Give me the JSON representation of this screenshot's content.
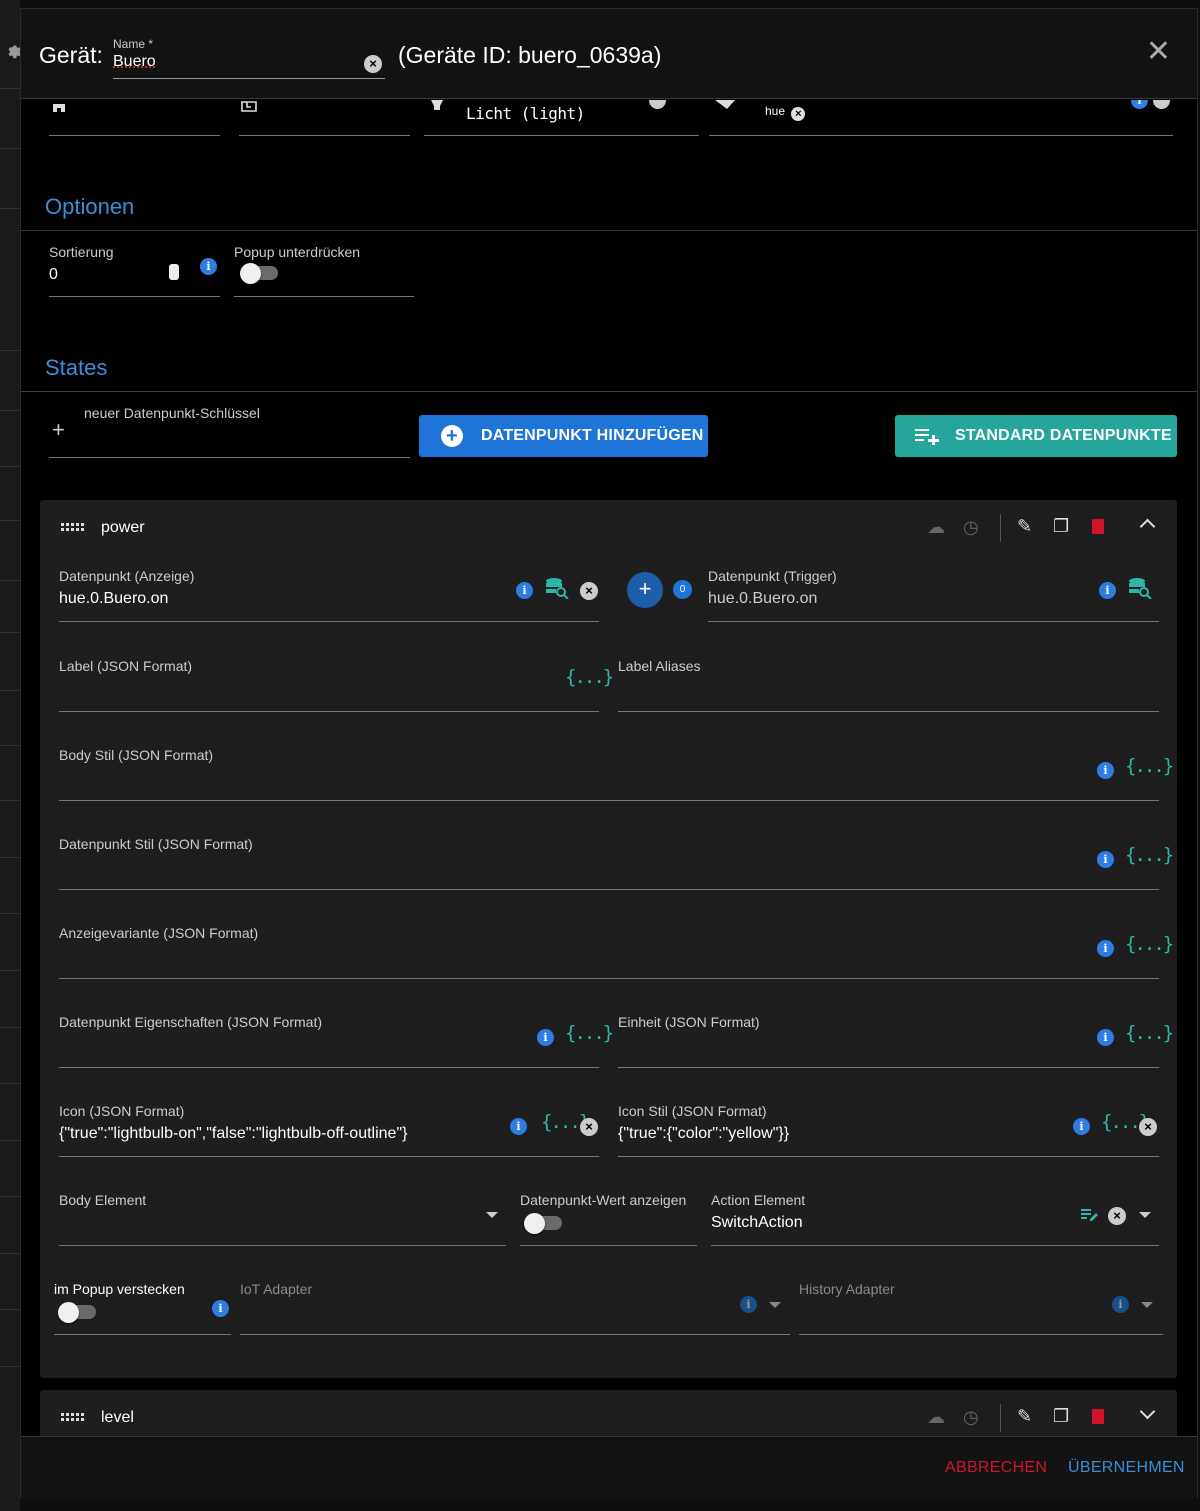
{
  "header": {
    "device_label": "Gerät:",
    "name_label": "Name *",
    "name_value": "Buero",
    "device_id": "(Geräte ID: buero_0639a)"
  },
  "top_row": {
    "function_value": "Licht (light)",
    "chip": "hue"
  },
  "options": {
    "title": "Optionen",
    "sort_label": "Sortierung",
    "sort_value": "0",
    "popup_label": "Popup unterdrücken",
    "popup_on": false
  },
  "states": {
    "title": "States",
    "new_key_label": "neuer Datenpunkt-Schlüssel",
    "add_button": "DATENPUNKT HINZUFÜGEN",
    "standard_button": "STANDARD DATENPUNKTE"
  },
  "power": {
    "title": "power",
    "dp_display_label": "Datenpunkt (Anzeige)",
    "dp_display_value": "hue.0.Buero.on",
    "trigger_badge": "0",
    "dp_trigger_label": "Datenpunkt (Trigger)",
    "dp_trigger_value": "hue.0.Buero.on",
    "label_json": "Label (JSON Format)",
    "label_aliases": "Label Aliases",
    "body_style": "Body Stil (JSON Format)",
    "dp_style": "Datenpunkt Stil (JSON Format)",
    "display_variant": "Anzeigevariante (JSON Format)",
    "dp_props": "Datenpunkt Eigenschaften (JSON Format)",
    "unit": "Einheit (JSON Format)",
    "icon_label": "Icon (JSON Format)",
    "icon_value": "{\"true\":\"lightbulb-on\",\"false\":\"lightbulb-off-outline\"}",
    "icon_style_label": "Icon Stil (JSON Format)",
    "icon_style_value": "{\"true\":{\"color\":\"yellow\"}}",
    "body_element": "Body Element",
    "show_dp_value": "Datenpunkt-Wert anzeigen",
    "action_element_label": "Action Element",
    "action_element_value": "SwitchAction",
    "hide_in_popup": "im Popup verstecken",
    "iot_adapter": "IoT Adapter",
    "history_adapter": "History Adapter"
  },
  "level": {
    "title": "level"
  },
  "footer": {
    "cancel": "ABBRECHEN",
    "apply": "ÜBERNEHMEN"
  },
  "json_glyph": "{...}",
  "colors": {
    "accent_blue": "#3a8fd8",
    "button_blue": "#1e74d7",
    "button_teal": "#26a69a",
    "json_teal": "#2cb7a6",
    "delete_red": "#d0142c"
  }
}
